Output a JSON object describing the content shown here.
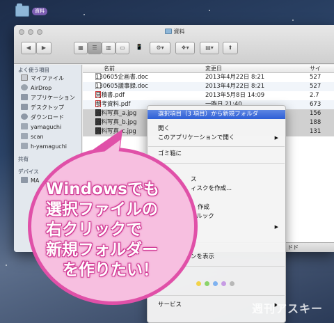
{
  "desktop": {
    "folder_label": "資料"
  },
  "window": {
    "title": "資料",
    "toolbar": {
      "back": "◀",
      "forward": "▶",
      "gear": "⚙▾",
      "share": "⬆",
      "dropbox": "▾",
      "arrange": "▾"
    }
  },
  "sidebar": {
    "favorites_header": "よく使う項目",
    "items": [
      {
        "label": "マイファイル",
        "icon": "files-icon"
      },
      {
        "label": "AirDrop",
        "icon": "airdrop-icon"
      },
      {
        "label": "アプリケーション",
        "icon": "apps-icon"
      },
      {
        "label": "デスクトップ",
        "icon": "desktop-icon"
      },
      {
        "label": "ダウンロード",
        "icon": "download-icon"
      },
      {
        "label": "yamaguchi",
        "icon": "folder-icon"
      },
      {
        "label": "scan",
        "icon": "folder-icon"
      },
      {
        "label": "h-yamaguchi",
        "icon": "folder-icon"
      }
    ],
    "shared_header": "共有",
    "devices_header": "デバイス",
    "device_label": "MA"
  },
  "filelist": {
    "columns": {
      "name": "名前",
      "modified": "変更日",
      "size": "サイ"
    },
    "rows": [
      {
        "name": "130605企画書.doc",
        "date": "2013年4月22日 8:21",
        "size": "527",
        "kind": "doc"
      },
      {
        "name": "130605議事録.doc",
        "date": "2013年4月22日 8:21",
        "size": "527",
        "kind": "doc"
      },
      {
        "name": "見積書.pdf",
        "date": "2013年5月8日 14:09",
        "size": "2.7",
        "kind": "pdf"
      },
      {
        "name": "参考資料.pdf",
        "date": "一昨日 21:40",
        "size": "673",
        "kind": "pdf"
      },
      {
        "name": "資料写真_a.jpg",
        "date": "",
        "size": "156",
        "kind": "img"
      },
      {
        "name": "資料写真_b.jpg",
        "date": "",
        "size": "188",
        "kind": "img"
      },
      {
        "name": "資料写真_c.jpg",
        "date": "",
        "size": "131",
        "kind": "img"
      }
    ],
    "status_partial": "ドド"
  },
  "context_menu": {
    "new_folder_item": "選択項目（3 項目）から新規フォルダ",
    "open": "開く",
    "open_with": "このアプリケーションで開く",
    "trash": "ゴミ箱に",
    "item_a": "ス",
    "item_b": "ィスクを作成...",
    "item_c": "作成",
    "item_d": "クルック",
    "item_e": "ンを表示",
    "services": "サービス"
  },
  "callout": {
    "lines": [
      "Windowsでも",
      "選択ファイルの",
      "右クリックで",
      "新規フォルダー",
      "を作りたい！"
    ]
  },
  "watermark": "週刊アスキー",
  "colors": {
    "bubble_fill": "#f7bfe0",
    "bubble_border": "#e050a8",
    "menu_highlight": "#2d5ed6"
  }
}
